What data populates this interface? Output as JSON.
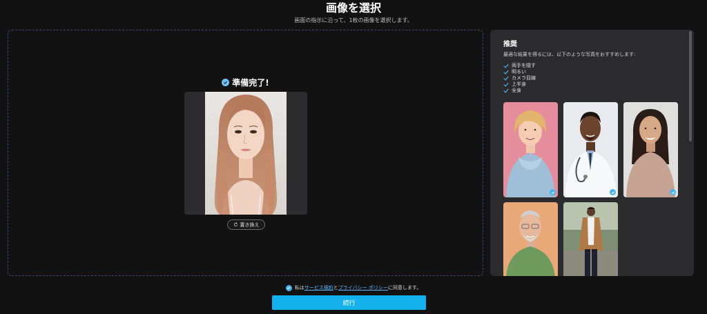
{
  "header": {
    "title": "画像を選択",
    "subtitle": "画面の指示に沿って、1枚の画像を選択します。"
  },
  "upload": {
    "status": "準備完了!",
    "replace_label": "置き換え"
  },
  "panel": {
    "title": "推奨",
    "description": "最適な結果を得るには、以下のような写真をおすすめします:",
    "criteria": [
      "両手を隠す",
      "明るい",
      "カメラ目線",
      "上半身",
      "全身"
    ]
  },
  "footer": {
    "agree_prefix": "私は",
    "terms_link": "サービス規約",
    "and": "と",
    "privacy_link": "プライバシー ポリシー",
    "agree_suffix": "に同意します。",
    "continue_label": "続行"
  },
  "colors": {
    "accent": "#14b1ec",
    "link": "#5fb8ff",
    "panel_bg": "#2b2b2d",
    "page_bg": "#121212"
  }
}
